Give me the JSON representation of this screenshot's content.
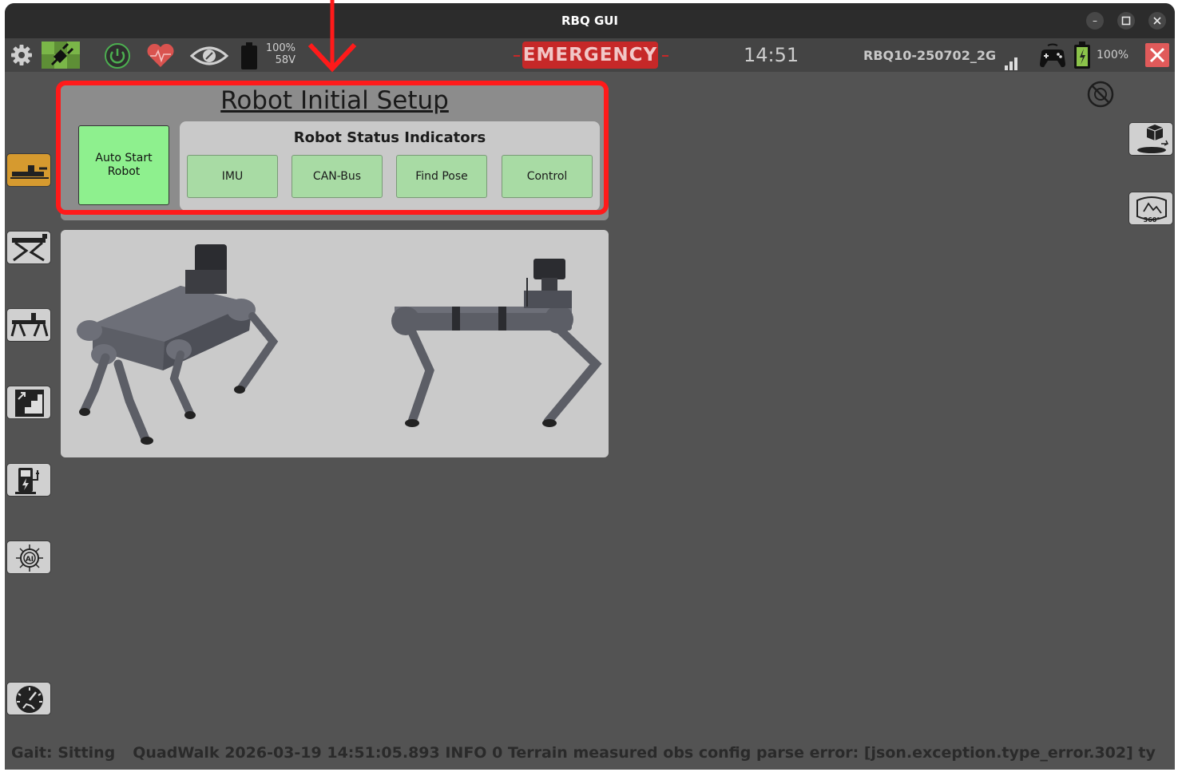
{
  "window": {
    "title": "RBQ GUI"
  },
  "statusbar": {
    "battery_percent": "100%",
    "battery_voltage": "58V",
    "emergency_label": "EMERGENCY",
    "clock": "14:51",
    "robot_id": "RBQ10-250702_2G",
    "controller_battery": "100%"
  },
  "setup": {
    "title": "Robot Initial Setup",
    "auto_start_label": "Auto Start Robot",
    "status_title": "Robot Status Indicators",
    "indicators": [
      "IMU",
      "CAN-Bus",
      "Find Pose",
      "Control"
    ]
  },
  "log": {
    "gait": "Gait: Sitting",
    "message": "QuadWalk 2026-03-19 14:51:05.893 INFO 0 Terrain measured obs config parse error: [json.exception.type_error.302] ty"
  },
  "colors": {
    "emergency": "#c62828",
    "status_indicator": "#a8dba4",
    "auto_start": "#8ef08e",
    "highlight": "#ff1a1a"
  }
}
